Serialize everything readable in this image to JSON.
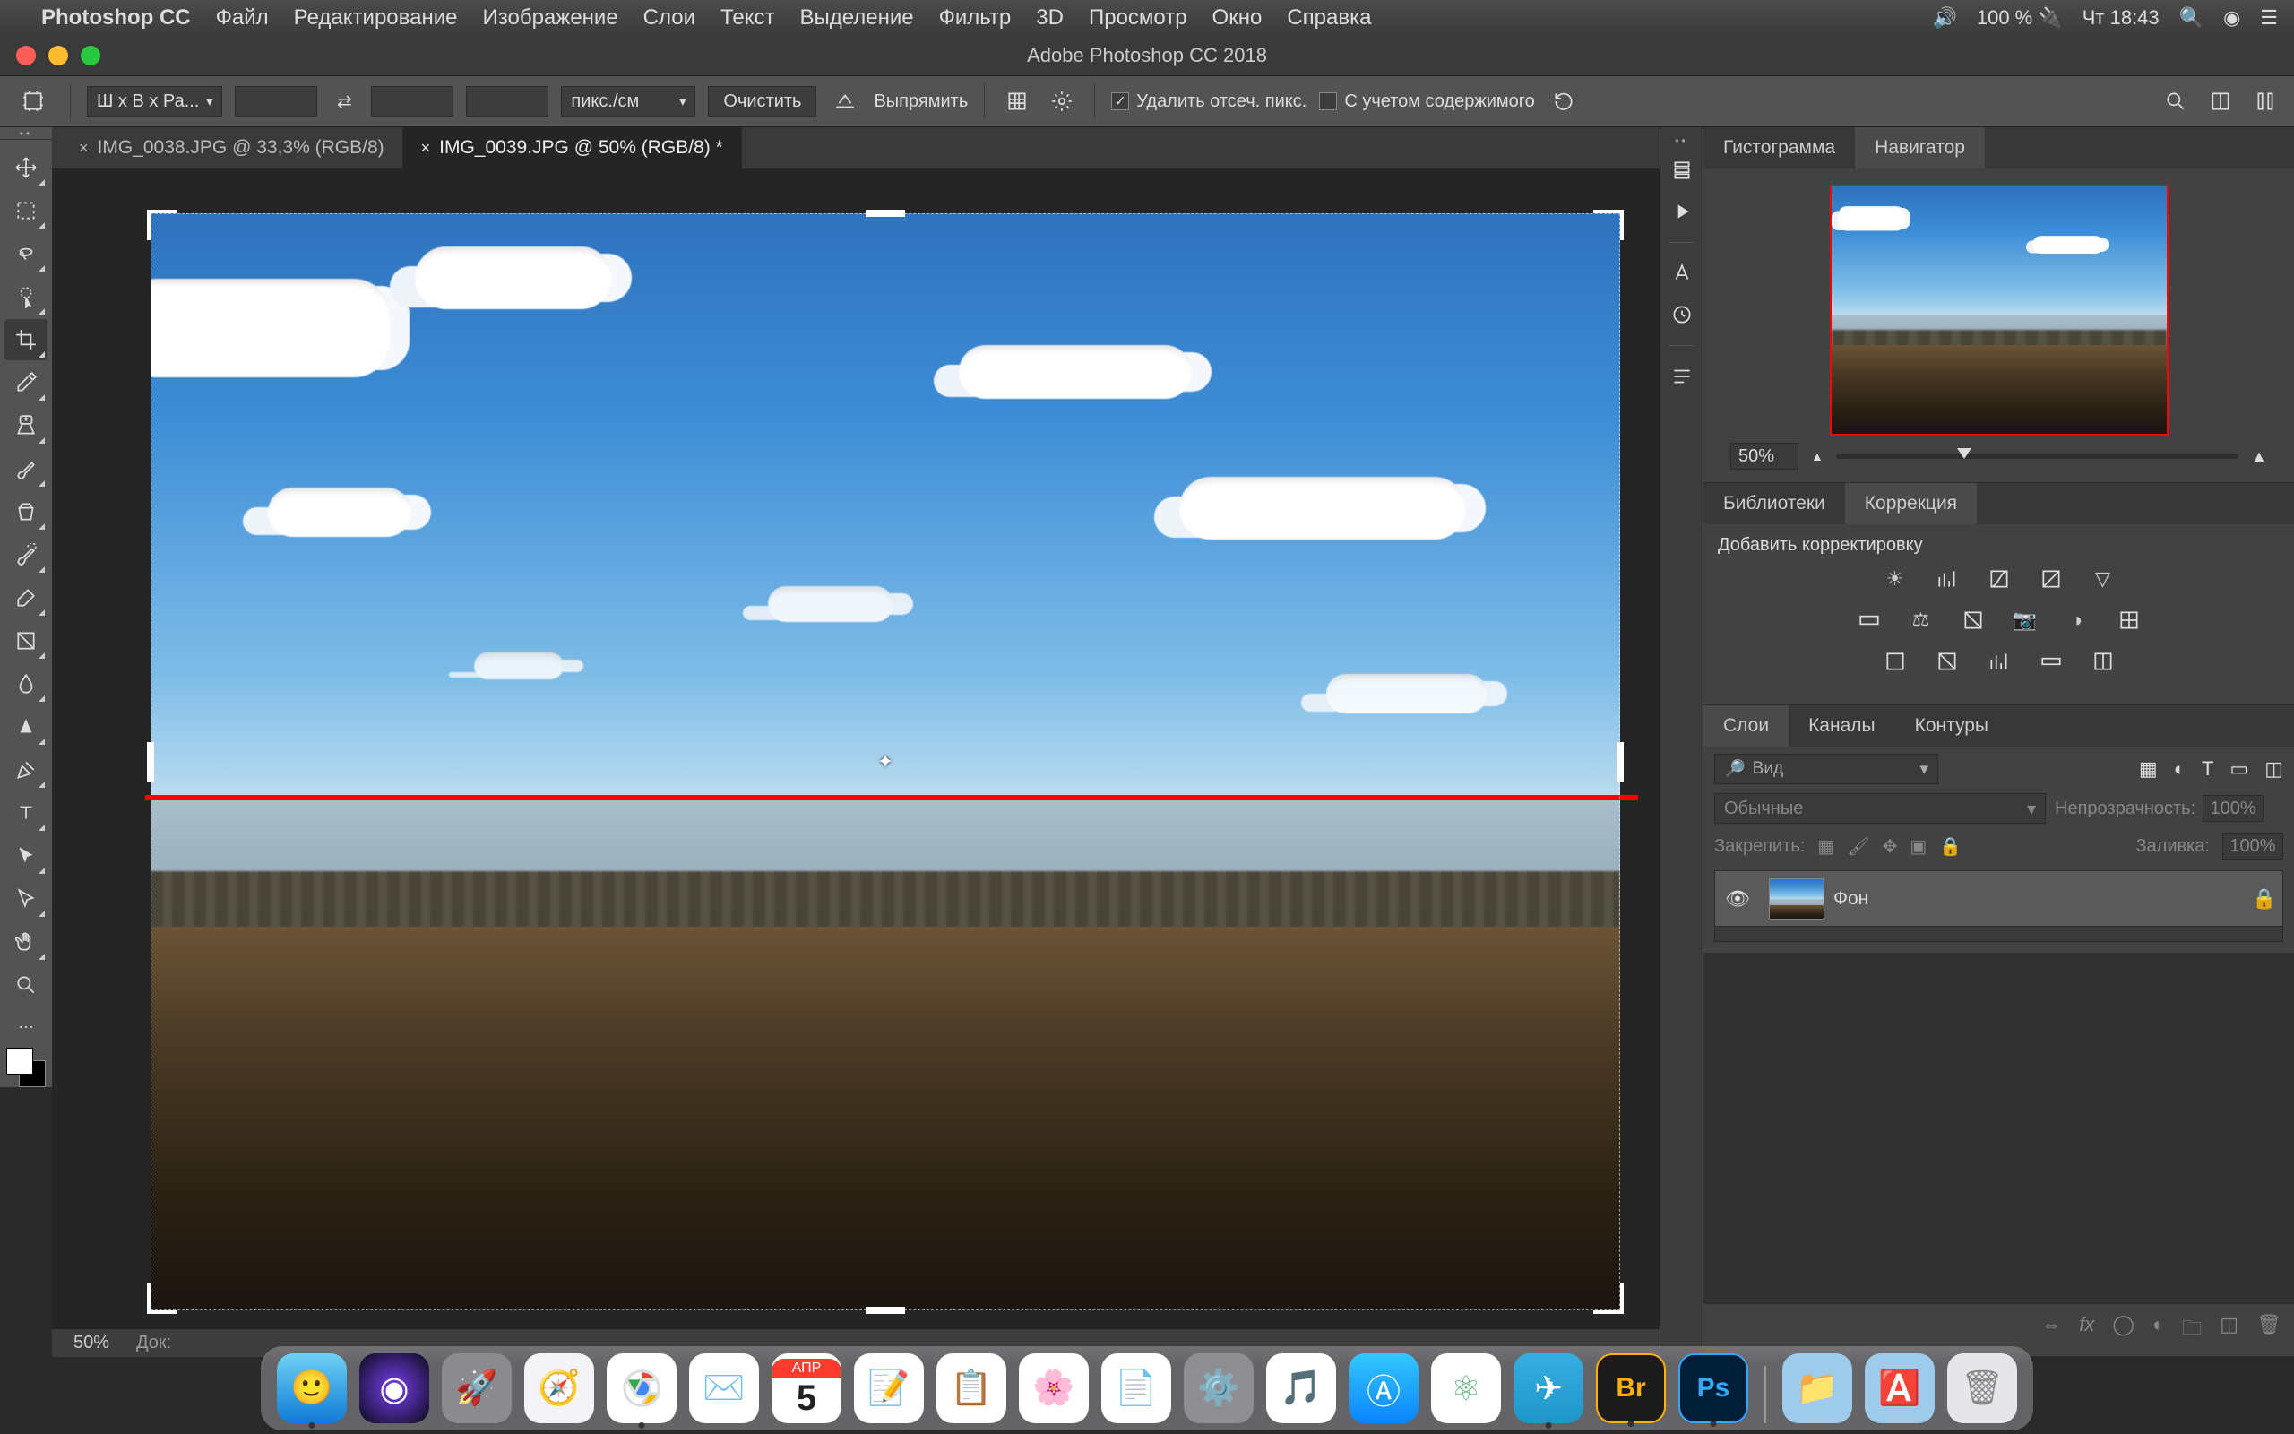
{
  "menubar": {
    "app": "Photoshop CC",
    "items": [
      "Файл",
      "Редактирование",
      "Изображение",
      "Слои",
      "Текст",
      "Выделение",
      "Фильтр",
      "3D",
      "Просмотр",
      "Окно",
      "Справка"
    ],
    "status": {
      "battery": "100 %",
      "time": "Чт 18:43"
    }
  },
  "window": {
    "title": "Adobe Photoshop CC 2018"
  },
  "options": {
    "ratio_dd": "Ш x В x Ра...",
    "units_dd": "пикс./см",
    "clear_btn": "Очистить",
    "straighten_btn": "Выпрямить",
    "delete_cropped": {
      "label": "Удалить отсеч. пикс.",
      "checked": true
    },
    "content_aware": {
      "label": "С учетом содержимого",
      "checked": false
    }
  },
  "tabs": [
    {
      "label": "IMG_0038.JPG @ 33,3% (RGB/8)",
      "active": false
    },
    {
      "label": "IMG_0039.JPG @ 50% (RGB/8) *",
      "active": true
    }
  ],
  "statusbar": {
    "zoom": "50%",
    "doc_label": "Док:"
  },
  "panels": {
    "nav_tabs": [
      "Гистограмма",
      "Навигатор"
    ],
    "nav_active": 1,
    "nav_zoom": "50%",
    "lib_tabs": [
      "Библиотеки",
      "Коррекция"
    ],
    "lib_active": 1,
    "adjust_title": "Добавить корректировку",
    "layer_tabs": [
      "Слои",
      "Каналы",
      "Контуры"
    ],
    "layer_active": 0,
    "search_placeholder": "Вид",
    "blend_mode": "Обычные",
    "opacity_label": "Непрозрачность:",
    "opacity_value": "100%",
    "lock_label": "Закрепить:",
    "fill_label": "Заливка:",
    "fill_value": "100%",
    "layers": [
      {
        "name": "Фон",
        "locked": true
      }
    ]
  },
  "dock": {
    "apps": [
      "finder",
      "siri",
      "launchpad",
      "safari",
      "chrome",
      "mail",
      "calendar",
      "notes",
      "reminders",
      "photos",
      "pages",
      "settings",
      "music",
      "appstore",
      "atom",
      "telegram",
      "bridge",
      "photoshop"
    ],
    "calendar": {
      "month": "АПР",
      "day": "5"
    },
    "right": [
      "downloads",
      "applications",
      "trash"
    ]
  },
  "colors": {
    "ui_dark": "#3a3a3a",
    "accent_red": "#ff0000"
  }
}
